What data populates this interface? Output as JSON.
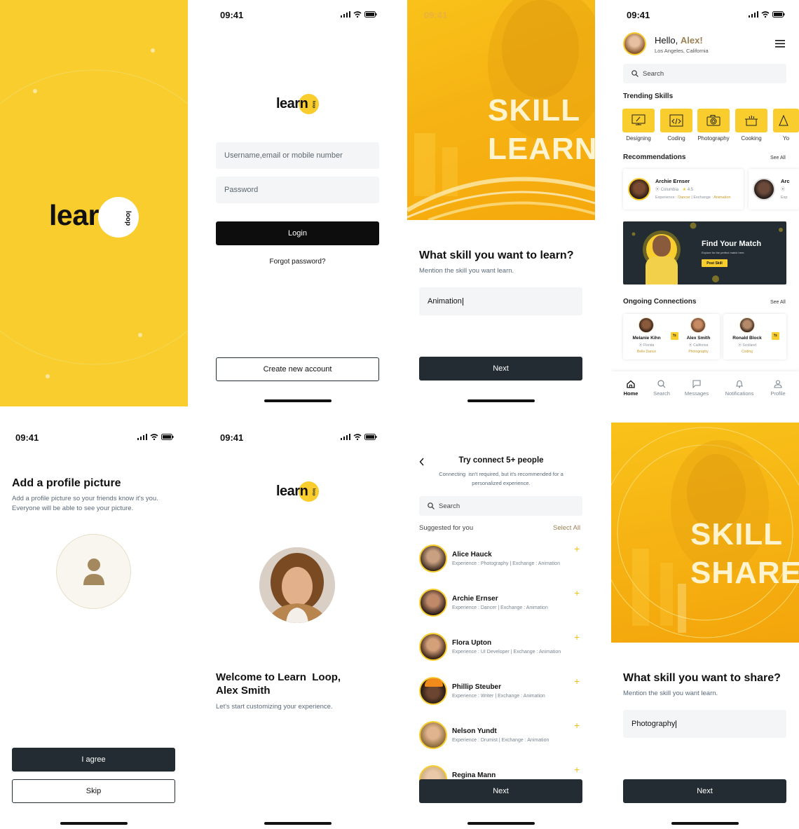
{
  "status": {
    "time": "09:41"
  },
  "logo": {
    "word": "learn",
    "sub": "loop"
  },
  "login": {
    "username_placeholder": "Username,email or mobile number",
    "password_placeholder": "Password",
    "login_label": "Login",
    "forgot_label": "Forgot password?",
    "create_label": "Create new account"
  },
  "learn_skill": {
    "hero_line1": "SKILL",
    "hero_line2": "LEARN",
    "title": "What skill you want to learn?",
    "subtitle": "Mention the skill you want learn.",
    "input_value": "Animation",
    "next_label": "Next"
  },
  "home": {
    "greeting": "Hello,",
    "user_name": "Alex!",
    "location": "Los Angeles, California",
    "search_placeholder": "Search",
    "trending_title": "Trending Skills",
    "skills": [
      {
        "label": "Designing",
        "icon": "design-icon"
      },
      {
        "label": "Coding",
        "icon": "code-icon"
      },
      {
        "label": "Photography",
        "icon": "camera-icon"
      },
      {
        "label": "Cooking",
        "icon": "cooking-icon"
      },
      {
        "label": "Yo",
        "icon": "yoga-icon"
      }
    ],
    "recommendations_title": "Recommendations",
    "see_all": "See All",
    "recommendations": [
      {
        "name": "Archie Ernser",
        "location": "Columbia",
        "rating": "4.5",
        "exp_label": "Experience :",
        "exp_value": "Dancer",
        "exch_label": "Exchange :",
        "exch_value": "Animation"
      },
      {
        "name": "Arc",
        "location": "",
        "rating": "",
        "exp_label": "Exp",
        "exp_value": "",
        "exch_label": "",
        "exch_value": ""
      }
    ],
    "banner_title": "Find Your Match",
    "banner_subtitle": "Explore for the perfect match here.",
    "banner_button": "Post Skill",
    "ongoing_title": "Ongoing Connections",
    "connections": [
      {
        "name": "Melanie Kihn",
        "location": "Florida",
        "skill": "Belle Dance"
      },
      {
        "name": "Alex Smith",
        "location": "California",
        "skill": "Photography"
      },
      {
        "name": "Ronald Block",
        "location": "Scotland",
        "skill": "Coding"
      }
    ],
    "nav": [
      {
        "label": "Home",
        "icon": "home-icon"
      },
      {
        "label": "Search",
        "icon": "search-icon"
      },
      {
        "label": "Messages",
        "icon": "message-icon"
      },
      {
        "label": "Notifications",
        "icon": "bell-icon"
      },
      {
        "label": "Profile",
        "icon": "profile-icon"
      }
    ]
  },
  "profile_pic": {
    "title": "Add a profile picture",
    "subtitle_1": "Add a profile picture so your friends know it's you.",
    "subtitle_2": "Everyone will be able to see your picture.",
    "agree_label": "I agree",
    "skip_label": "Skip"
  },
  "welcome": {
    "title_1": "Welcome to Learn  Loop,",
    "title_2": "Alex Smith",
    "subtitle": "Let's start customizing your experience."
  },
  "connect": {
    "title": "Try connect 5+ people",
    "subtitle_1": "Connecting  isn't required, but it's recommended for a",
    "subtitle_2": "personalized experience.",
    "search_placeholder": "Search",
    "suggested_label": "Suggested for you",
    "select_all": "Select All",
    "people": [
      {
        "name": "Alice Hauck",
        "meta": "Experience : Photography | Exchange : Animation"
      },
      {
        "name": "Archie Ernser",
        "meta": "Experience : Dancer | Exchange : Animation"
      },
      {
        "name": "Flora Upton",
        "meta": "Experience : UI Developer | Exchange : Animation"
      },
      {
        "name": "Phillip Steuber",
        "meta": "Experience : Writer | Exchange : Animation"
      },
      {
        "name": "Nelson Yundt",
        "meta": "Experience : Drumist | Exchange : Animation"
      },
      {
        "name": "Regina Mann",
        "meta": ""
      }
    ],
    "plus": "+",
    "next_label": "Next"
  },
  "share_skill": {
    "hero_line1": "SKILL",
    "hero_line2": "SHARE",
    "title": "What skill you want to share?",
    "subtitle": "Mention the skill you want learn.",
    "input_value": "Photography",
    "next_label": "Next"
  },
  "colors": {
    "accent": "#f8cd2d",
    "dark": "#232c32",
    "brown": "#9c8055"
  }
}
